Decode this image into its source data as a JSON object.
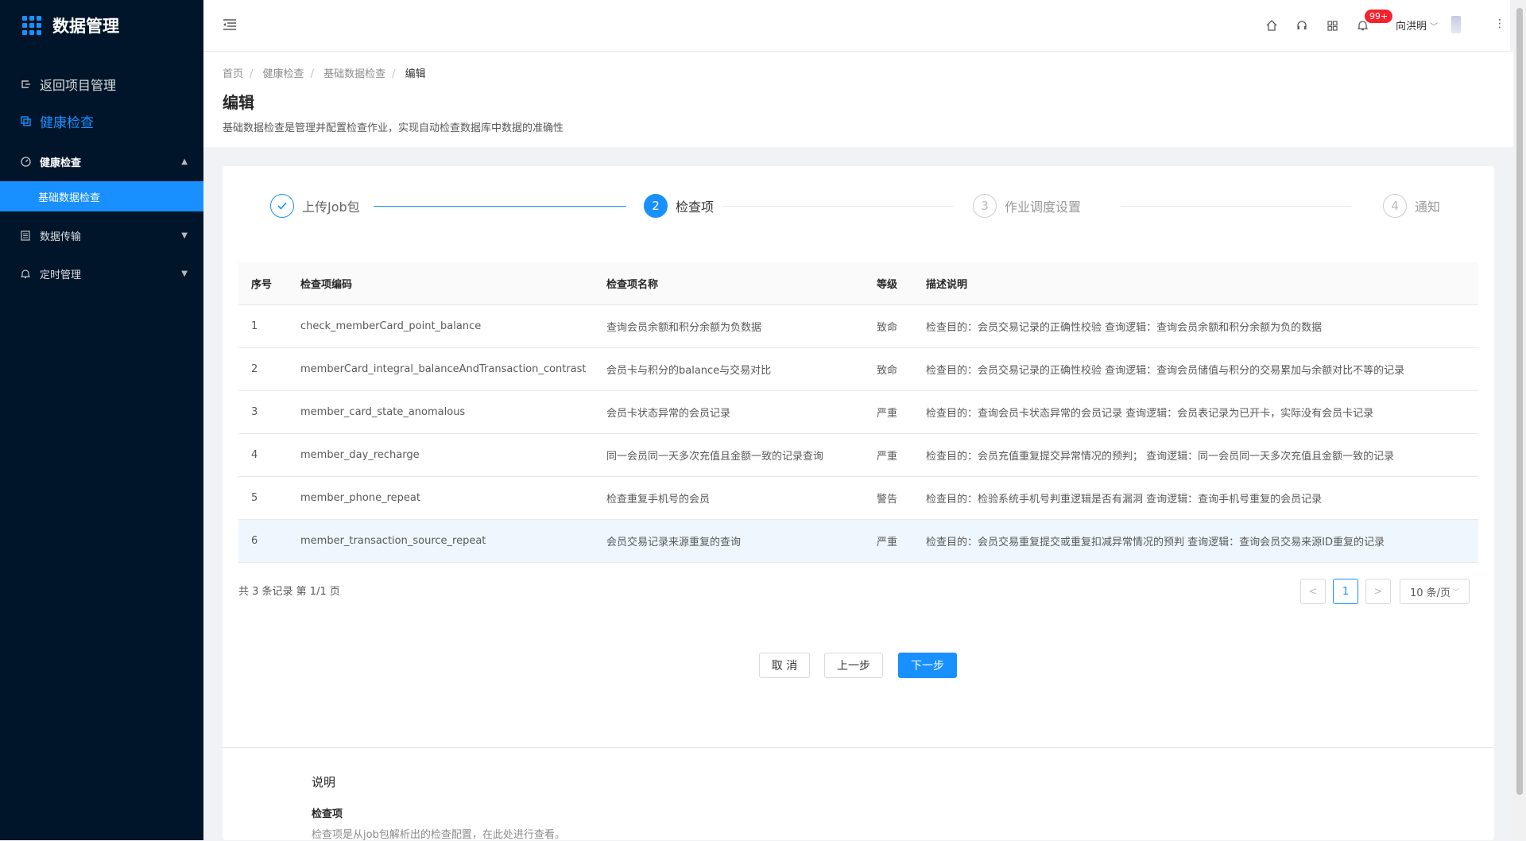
{
  "app": {
    "title": "数据管理"
  },
  "sidebar": {
    "back_label": "返回项目管理",
    "section_label": "健康检查",
    "groups": [
      {
        "label": "健康检查",
        "expanded": true,
        "children": [
          "基础数据检查"
        ]
      },
      {
        "label": "数据传输",
        "expanded": false
      },
      {
        "label": "定时管理",
        "expanded": false
      }
    ]
  },
  "header": {
    "badge": "99+",
    "user": "向洪明"
  },
  "breadcrumb": [
    "首页",
    "健康检查",
    "基础数据检查",
    "编辑"
  ],
  "page": {
    "title": "编辑",
    "description": "基础数据检查是管理并配置检查作业，实现自动检查数据库中数据的准确性"
  },
  "steps": [
    {
      "num": "1",
      "label": "上传Job包",
      "status": "done"
    },
    {
      "num": "2",
      "label": "检查项",
      "status": "current"
    },
    {
      "num": "3",
      "label": "作业调度设置",
      "status": "wait"
    },
    {
      "num": "4",
      "label": "通知",
      "status": "wait"
    }
  ],
  "table": {
    "headers": [
      "序号",
      "检查项编码",
      "检查项名称",
      "等级",
      "描述说明"
    ],
    "rows": [
      [
        "1",
        "check_memberCard_point_balance",
        "查询会员余额和积分余额为负数据",
        "致命",
        "检查目的：会员交易记录的正确性校验 查询逻辑：查询会员余额和积分余额为负的数据"
      ],
      [
        "2",
        "memberCard_integral_balanceAndTransaction_contrast",
        "会员卡与积分的balance与交易对比",
        "致命",
        "检查目的：会员交易记录的正确性校验 查询逻辑：查询会员储值与积分的交易累加与余额对比不等的记录"
      ],
      [
        "3",
        "member_card_state_anomalous",
        "会员卡状态异常的会员记录",
        "严重",
        "检查目的：查询会员卡状态异常的会员记录 查询逻辑：会员表记录为已开卡，实际没有会员卡记录"
      ],
      [
        "4",
        "member_day_recharge",
        "同一会员同一天多次充值且金额一致的记录查询",
        "严重",
        "检查目的：会员充值重复提交异常情况的预判； 查询逻辑：同一会员同一天多次充值且金额一致的记录"
      ],
      [
        "5",
        "member_phone_repeat",
        "检查重复手机号的会员",
        "警告",
        "检查目的：检验系统手机号判重逻辑是否有漏洞 查询逻辑：查询手机号重复的会员记录"
      ],
      [
        "6",
        "member_transaction_source_repeat",
        "会员交易记录来源重复的查询",
        "严重",
        "检查目的：会员交易重复提交或重复扣减异常情况的预判 查询逻辑：查询会员交易来源ID重复的记录"
      ]
    ],
    "highlight_row": 6
  },
  "pagination": {
    "summary": "共 3 条记录 第 1/1 页",
    "current_page": "1",
    "prev": "<",
    "next": ">",
    "page_size": "10 条/页"
  },
  "buttons": {
    "cancel": "取 消",
    "prev": "上一步",
    "next": "下一步"
  },
  "note": {
    "title": "说明",
    "subtitle": "检查项",
    "text": "检查项是从job包解析出的检查配置，在此处进行查看。"
  },
  "colors": {
    "sidebar_bg": "#001529",
    "primary": "#1890ff",
    "badge": "#f5222d"
  }
}
